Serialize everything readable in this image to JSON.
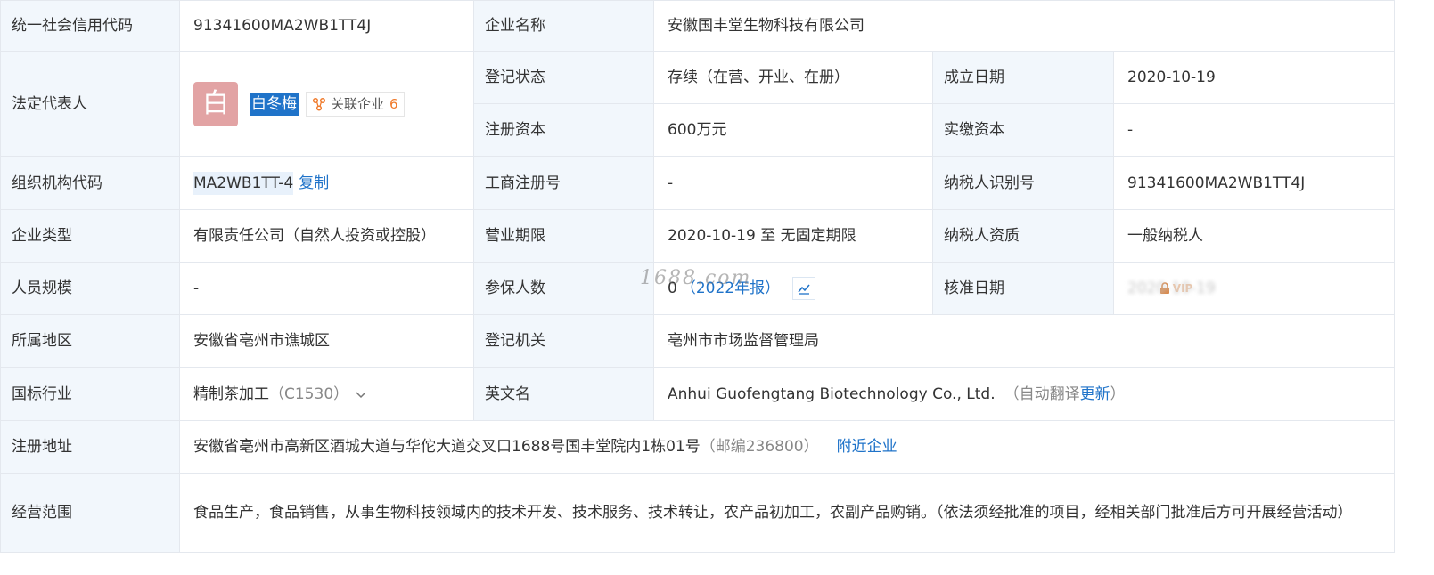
{
  "rows": {
    "credit_code": {
      "label": "统一社会信用代码",
      "value": "91341600MA2WB1TT4J"
    },
    "company_name": {
      "label": "企业名称",
      "value": "安徽国丰堂生物科技有限公司"
    },
    "legal_rep": {
      "label": "法定代表人",
      "avatar_char": "白",
      "name": "白冬梅",
      "related_label": "关联企业",
      "related_count": "6"
    },
    "reg_status": {
      "label": "登记状态",
      "value": "存续（在营、开业、在册）"
    },
    "founded": {
      "label": "成立日期",
      "value": "2020-10-19"
    },
    "reg_capital": {
      "label": "注册资本",
      "value": "600万元"
    },
    "paid_capital": {
      "label": "实缴资本",
      "value": "-"
    },
    "org_code": {
      "label": "组织机构代码",
      "value": "MA2WB1TT-4",
      "copy_label": "复制"
    },
    "biz_reg_no": {
      "label": "工商注册号",
      "value": "-"
    },
    "taxpayer_id": {
      "label": "纳税人识别号",
      "value": "91341600MA2WB1TT4J"
    },
    "company_type": {
      "label": "企业类型",
      "value": "有限责任公司（自然人投资或控股）"
    },
    "biz_term": {
      "label": "营业期限",
      "value": "2020-10-19 至 无固定期限"
    },
    "taxpayer_qual": {
      "label": "纳税人资质",
      "value": "一般纳税人"
    },
    "staff_size": {
      "label": "人员规模",
      "value": "-"
    },
    "insured": {
      "label": "参保人数",
      "value": "0",
      "report_link": "（2022年报）"
    },
    "approval_date": {
      "label": "核准日期",
      "blurred": "2020-10-19",
      "vip": "VIP"
    },
    "region": {
      "label": "所属地区",
      "value": "安徽省亳州市谯城区"
    },
    "authority": {
      "label": "登记机关",
      "value": "亳州市市场监督管理局"
    },
    "industry": {
      "label": "国标行业",
      "value": "精制茶加工",
      "code": "（C1530）"
    },
    "english_name": {
      "label": "英文名",
      "value": "Anhui Guofengtang Biotechnology Co., Ltd.",
      "hint_prefix": "（自动翻译",
      "hint_link": "更新",
      "hint_suffix": "）"
    },
    "address": {
      "label": "注册地址",
      "value": "安徽省亳州市高新区酒城大道与华佗大道交叉口1688号国丰堂院内1栋01号",
      "postcode": "（邮编236800）",
      "nearby_link": "附近企业"
    },
    "scope": {
      "label": "经营范围",
      "value": "食品生产，食品销售，从事生物科技领域内的技术开发、技术服务、技术转让，农产品初加工，农副产品购销。（依法须经批准的项目，经相关部门批准后方可开展经营活动）"
    }
  },
  "watermark": "1688.com",
  "colors": {
    "label_bg": "#f2f7fc",
    "link": "#1f73c9",
    "border": "#e4e8ee",
    "avatar_bg": "#e2a3a4",
    "count": "#f07a2b"
  },
  "icons": [
    "related-company-icon",
    "chevron-down-icon",
    "trend-chart-icon",
    "lock-icon"
  ]
}
